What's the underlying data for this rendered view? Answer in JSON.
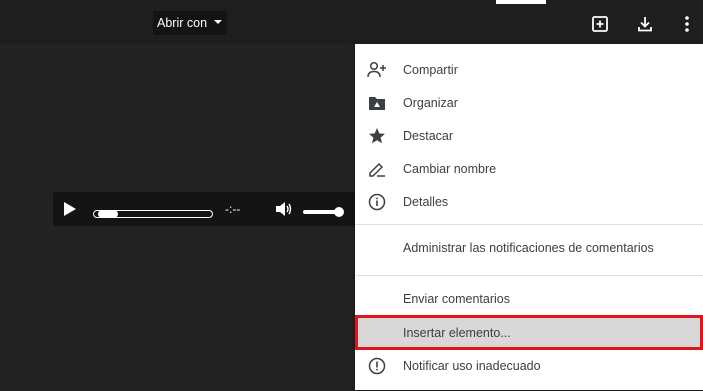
{
  "toolbar": {
    "open_with_label": "Abrir con",
    "icons": [
      "add-shortcut-icon",
      "download-icon",
      "more-vert-icon"
    ]
  },
  "player": {
    "time": "-:--",
    "progress": 0.05,
    "volume": 1.0
  },
  "menu": {
    "items": [
      {
        "label": "Compartir",
        "icon": "add-person-icon"
      },
      {
        "label": "Organizar",
        "icon": "folder-move-icon"
      },
      {
        "label": "Destacar",
        "icon": "star-icon"
      },
      {
        "label": "Cambiar nombre",
        "icon": "rename-pencil-icon"
      },
      {
        "label": "Detalles",
        "icon": "info-icon"
      },
      {
        "label": "Administrar las notificaciones de comentarios"
      },
      {
        "label": "Enviar comentarios"
      },
      {
        "label": "Insertar elemento...",
        "highlighted": true
      },
      {
        "label": "Notificar uso inadecuado",
        "icon": "report-icon"
      }
    ]
  },
  "colors": {
    "highlight_outline": "#e0141a",
    "highlight_fill": "#d8d8d8",
    "menu_text": "#3c4043",
    "background": "#232323"
  }
}
